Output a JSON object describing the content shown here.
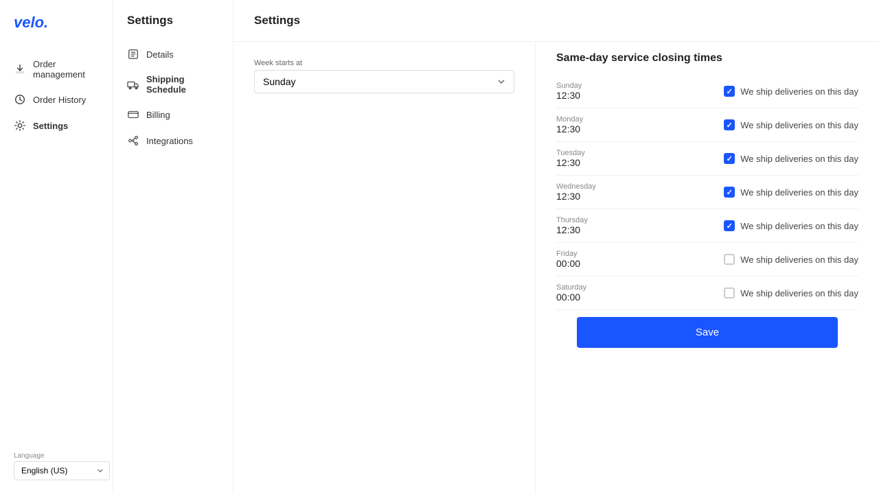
{
  "brand": {
    "name": "velo.",
    "color": "#1a56ff"
  },
  "sidebar": {
    "items": [
      {
        "id": "order-management",
        "label": "Order management",
        "icon": "download-icon",
        "active": false
      },
      {
        "id": "order-history",
        "label": "Order History",
        "icon": "history-icon",
        "active": false
      },
      {
        "id": "settings",
        "label": "Settings",
        "icon": "gear-icon",
        "active": true
      }
    ]
  },
  "submenu": {
    "title": "Settings",
    "items": [
      {
        "id": "details",
        "label": "Details",
        "icon": "details-icon",
        "active": false
      },
      {
        "id": "shipping-schedule",
        "label": "Shipping Schedule",
        "icon": "truck-icon",
        "active": true
      },
      {
        "id": "billing",
        "label": "Billing",
        "icon": "card-icon",
        "active": false
      },
      {
        "id": "integrations",
        "label": "Integrations",
        "icon": "integrations-icon",
        "active": false
      }
    ]
  },
  "main": {
    "title": "Settings",
    "week_starts_label": "Week starts at",
    "week_starts_value": "Sunday",
    "same_day_title": "Same-day service closing times",
    "days": [
      {
        "name": "Sunday",
        "time": "12:30",
        "checked": true
      },
      {
        "name": "Monday",
        "time": "12:30",
        "checked": true
      },
      {
        "name": "Tuesday",
        "time": "12:30",
        "checked": true
      },
      {
        "name": "Wednesday",
        "time": "12:30",
        "checked": true
      },
      {
        "name": "Thursday",
        "time": "12:30",
        "checked": true
      },
      {
        "name": "Friday",
        "time": "00:00",
        "checked": false
      },
      {
        "name": "Saturday",
        "time": "00:00",
        "checked": false
      }
    ],
    "checkbox_label": "We ship deliveries on this day",
    "save_label": "Save"
  },
  "footer": {
    "language_label": "Language",
    "language_value": "English (US)"
  }
}
